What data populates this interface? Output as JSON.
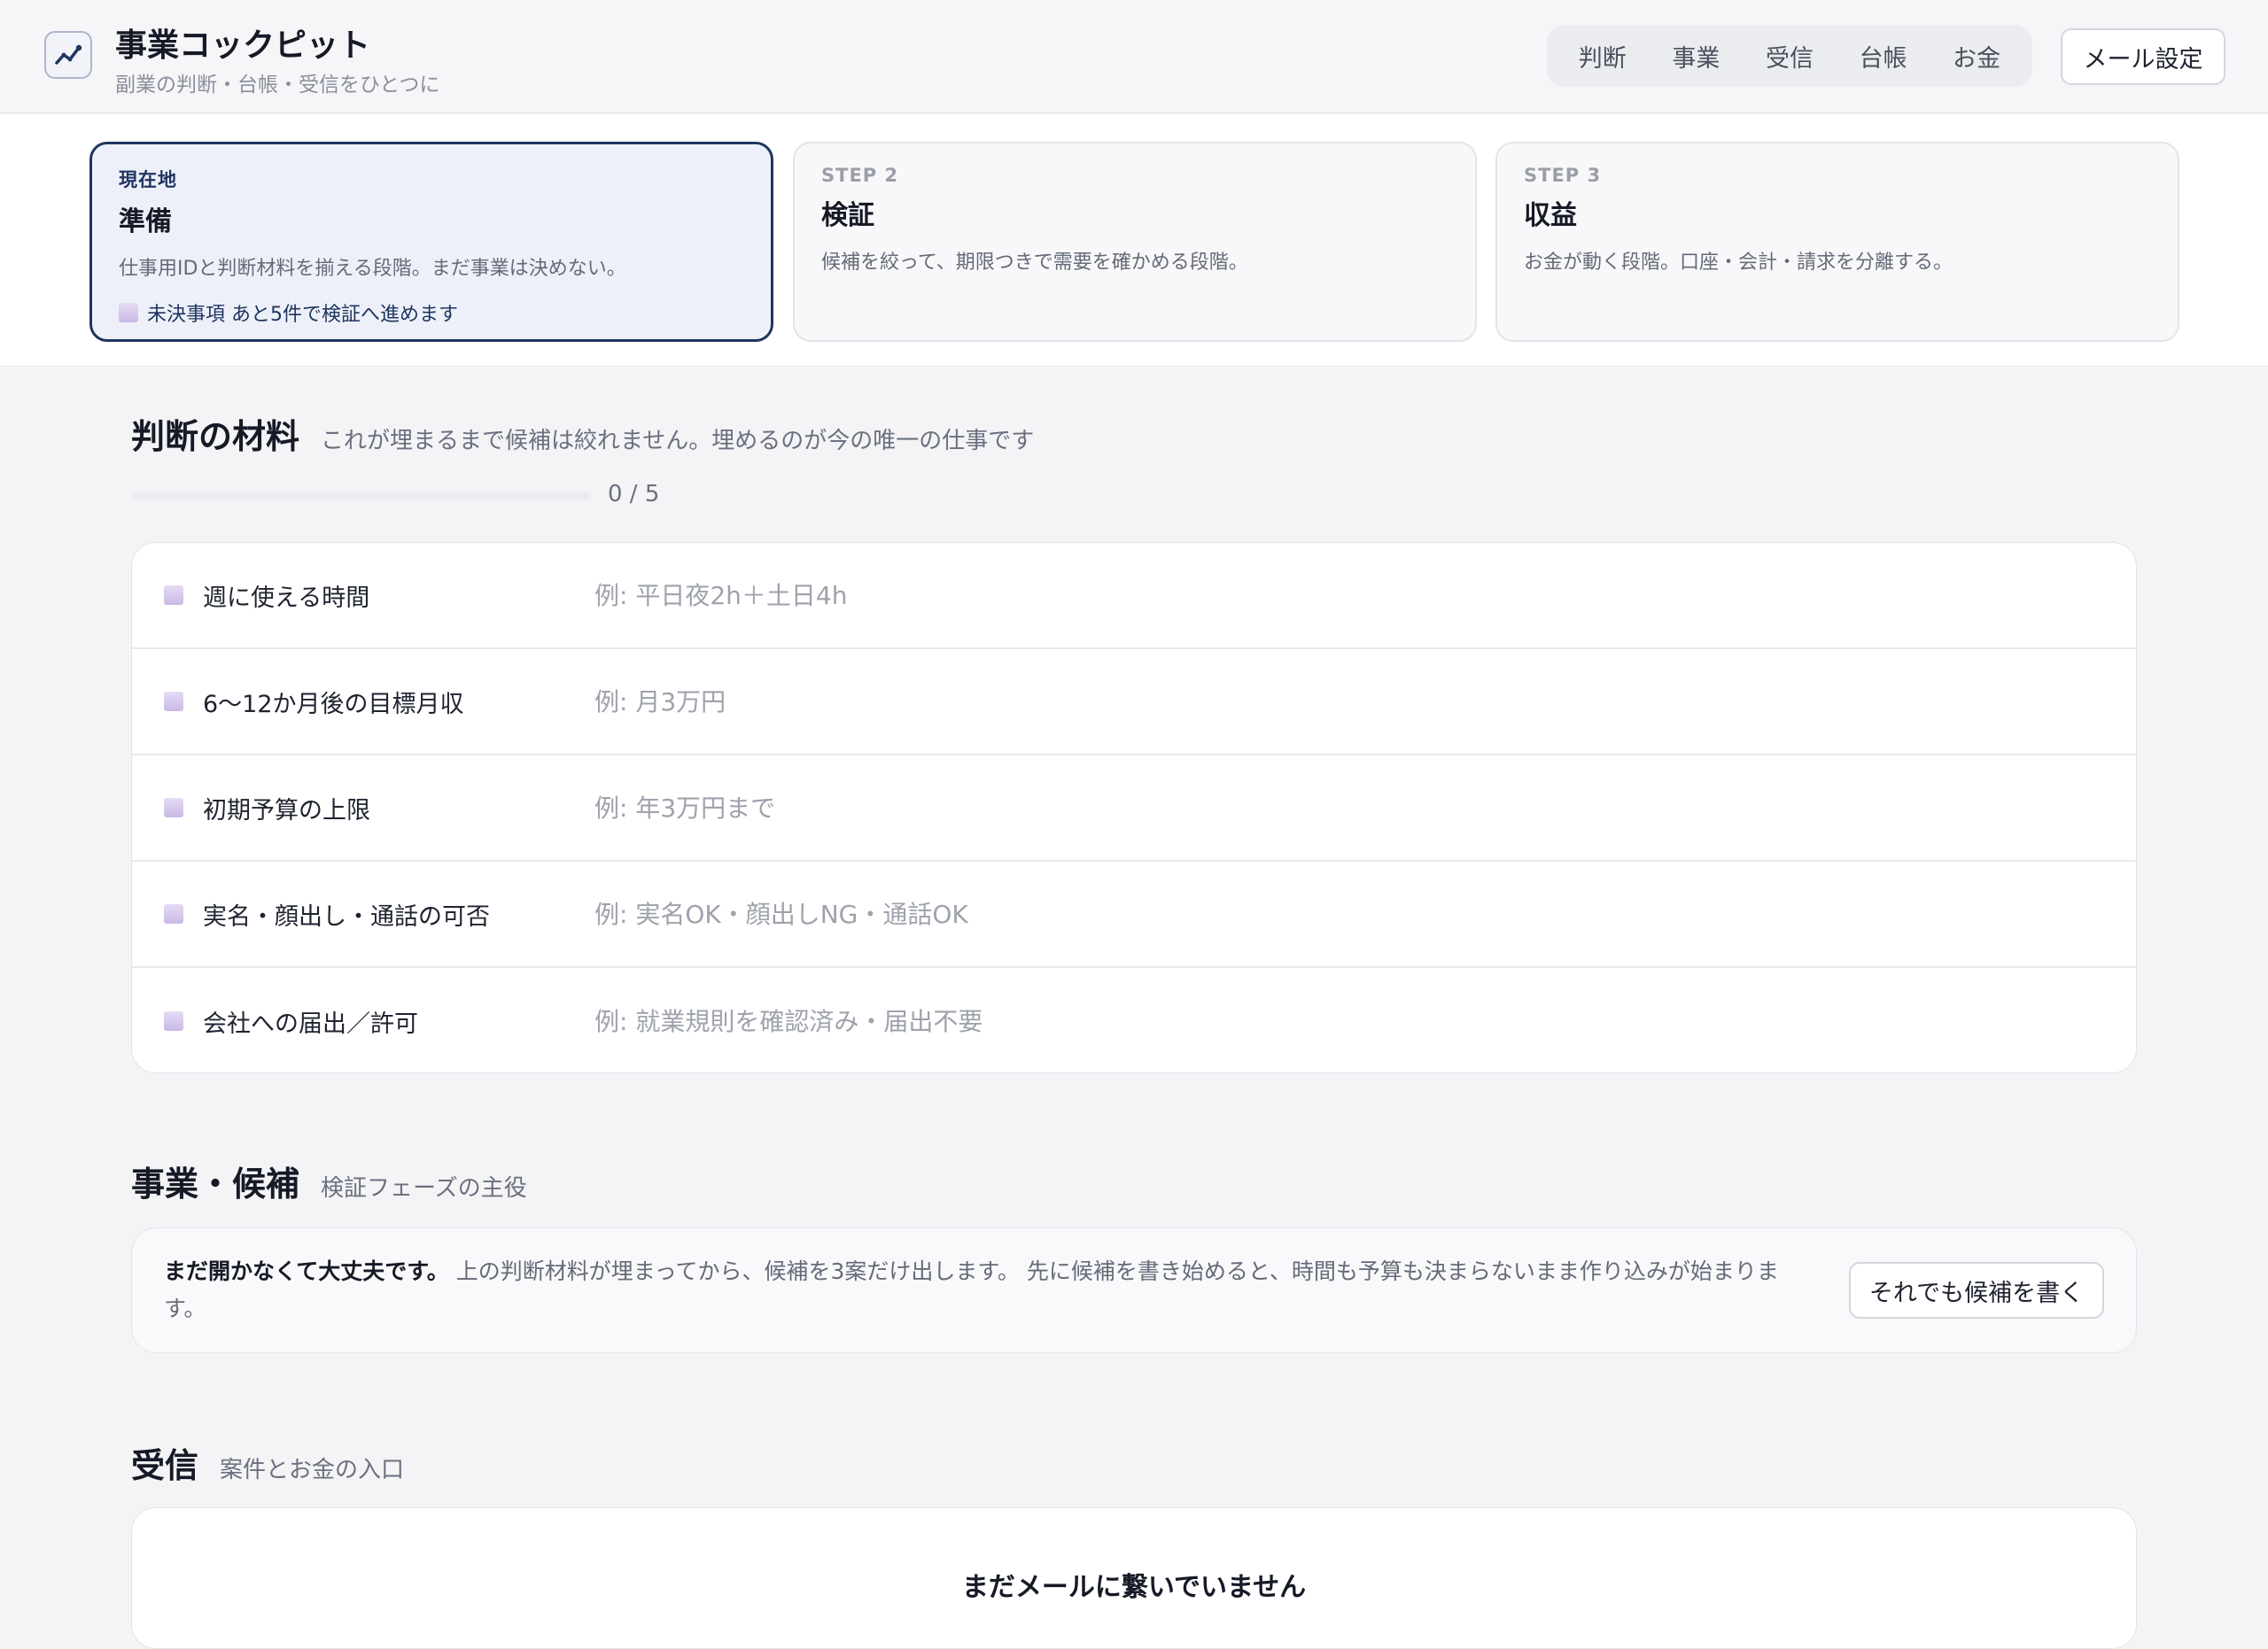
{
  "app": {
    "title": "事業コックピット",
    "subtitle": "副業の判断・台帳・受信をひとつに",
    "logo_icon": "trend-up-icon"
  },
  "nav": {
    "items": [
      {
        "label": "判断"
      },
      {
        "label": "事業"
      },
      {
        "label": "受信"
      },
      {
        "label": "台帳"
      },
      {
        "label": "お金"
      }
    ],
    "mail_settings": "メール設定"
  },
  "steps": [
    {
      "label": "現在地",
      "name": "準備",
      "desc": "仕事用IDと判断材料を揃える段階。まだ事業は決めない。",
      "note": "未決事項 あと5件で検証へ進めます",
      "current": true
    },
    {
      "label": "STEP 2",
      "name": "検証",
      "desc": "候補を絞って、期限つきで需要を確かめる段階。"
    },
    {
      "label": "STEP 3",
      "name": "収益",
      "desc": "お金が動く段階。口座・会計・請求を分離する。"
    }
  ],
  "criteria_section": {
    "title": "判断の材料",
    "subtitle": "これが埋まるまで候補は絞れません。埋めるのが今の唯一の仕事です",
    "progress_text": "0 / 5",
    "progress_fraction": 0,
    "items": [
      {
        "label": "週に使える時間",
        "placeholder": "例: 平日夜2h＋土日4h"
      },
      {
        "label": "6〜12か月後の目標月収",
        "placeholder": "例: 月3万円"
      },
      {
        "label": "初期予算の上限",
        "placeholder": "例: 年3万円まで"
      },
      {
        "label": "実名・顔出し・通話の可否",
        "placeholder": "例: 実名OK・顔出しNG・通話OK"
      },
      {
        "label": "会社への届出／許可",
        "placeholder": "例: 就業規則を確認済み・届出不要"
      }
    ]
  },
  "business_section": {
    "title": "事業・候補",
    "subtitle": "検証フェーズの主役",
    "notice_bold": "まだ開かなくて大丈夫です。",
    "notice_text": "上の判断材料が埋まってから、候補を3案だけ出します。 先に候補を書き始めると、時間も予算も決まらないまま作り込みが始まります。",
    "button": "それでも候補を書く"
  },
  "inbox_section": {
    "title": "受信",
    "subtitle": "案件とお金の入口",
    "empty_title": "まだメールに繋いでいません"
  },
  "colors": {
    "accent": "#1f3560",
    "checkbox": "#c9b8e6"
  }
}
